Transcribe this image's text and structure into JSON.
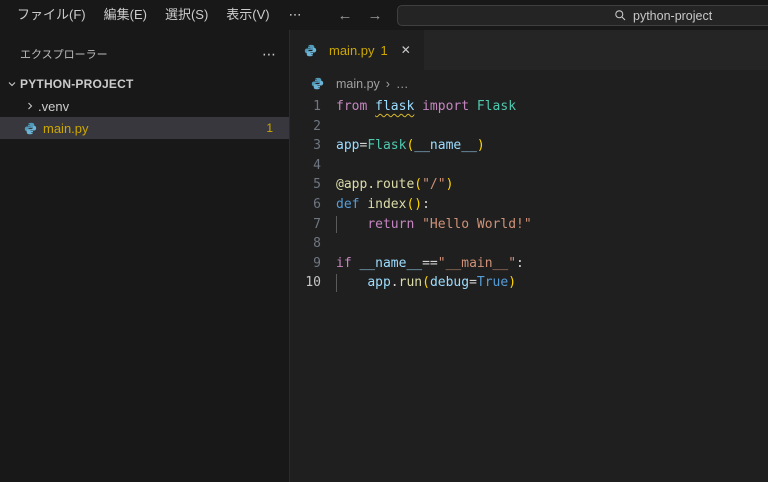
{
  "titlebar": {
    "menus": [
      "ファイル(F)",
      "編集(E)",
      "選択(S)",
      "表示(V)"
    ],
    "menu_more": "⋯",
    "back": "←",
    "forward": "→",
    "command_center": {
      "query": "python-project"
    }
  },
  "sidebar": {
    "header_title": "エクスプローラー",
    "header_more": "⋯",
    "root": {
      "label": "PYTHON-PROJECT"
    },
    "items": [
      {
        "label": ".venv",
        "kind": "folder-collapsed"
      },
      {
        "label": "main.py",
        "kind": "python-file",
        "badge": "1",
        "selected": true
      }
    ]
  },
  "editor": {
    "tab": {
      "label": "main.py",
      "badge": "1",
      "close": "✕"
    },
    "breadcrumb": {
      "file": "main.py",
      "separator": "›",
      "more": "…"
    },
    "code_lines": [
      {
        "n": 1,
        "tokens": [
          {
            "c": "kwc",
            "t": "from "
          },
          {
            "c": "var",
            "t": "flask",
            "sq": true
          },
          {
            "c": "pln",
            "t": " "
          },
          {
            "c": "kwc",
            "t": "import "
          },
          {
            "c": "cls",
            "t": "Flask"
          }
        ]
      },
      {
        "n": 2,
        "tokens": []
      },
      {
        "n": 3,
        "tokens": [
          {
            "c": "var",
            "t": "app"
          },
          {
            "c": "op",
            "t": "="
          },
          {
            "c": "cls",
            "t": "Flask"
          },
          {
            "c": "brk",
            "t": "("
          },
          {
            "c": "var",
            "t": "__name__"
          },
          {
            "c": "brk",
            "t": ")"
          }
        ]
      },
      {
        "n": 4,
        "tokens": []
      },
      {
        "n": 5,
        "tokens": [
          {
            "c": "fn",
            "t": "@app.route"
          },
          {
            "c": "brk",
            "t": "("
          },
          {
            "c": "str",
            "t": "\"/\""
          },
          {
            "c": "brk",
            "t": ")"
          }
        ]
      },
      {
        "n": 6,
        "tokens": [
          {
            "c": "kwb",
            "t": "def "
          },
          {
            "c": "fn",
            "t": "index"
          },
          {
            "c": "brk",
            "t": "()"
          },
          {
            "c": "op",
            "t": ":"
          }
        ]
      },
      {
        "n": 7,
        "indent": 4,
        "guide": true,
        "tokens": [
          {
            "c": "kwc",
            "t": "return "
          },
          {
            "c": "str",
            "t": "\"Hello World!\""
          }
        ]
      },
      {
        "n": 8,
        "tokens": []
      },
      {
        "n": 9,
        "tokens": [
          {
            "c": "kwc",
            "t": "if "
          },
          {
            "c": "var",
            "t": "__name__"
          },
          {
            "c": "op",
            "t": "=="
          },
          {
            "c": "str",
            "t": "\"__main__\""
          },
          {
            "c": "op",
            "t": ":"
          }
        ]
      },
      {
        "n": 10,
        "indent": 4,
        "guide": true,
        "active": true,
        "tokens": [
          {
            "c": "var",
            "t": "app"
          },
          {
            "c": "op",
            "t": "."
          },
          {
            "c": "fn",
            "t": "run"
          },
          {
            "c": "brk",
            "t": "("
          },
          {
            "c": "var",
            "t": "debug"
          },
          {
            "c": "op",
            "t": "="
          },
          {
            "c": "kwb",
            "t": "True"
          },
          {
            "c": "brk",
            "t": ")"
          }
        ]
      }
    ]
  },
  "palette": {
    "titlebar_bg": "#181818",
    "sidebar_bg": "#181818",
    "editor_bg": "#1f1f1f",
    "tabstrip_bg": "#252526",
    "selected_row_bg": "#37373d",
    "warning_gold": "#cca700",
    "python_icon_blue": "#519aba",
    "keyword_magenta": "#c586c0",
    "keyword_blue": "#569cd6",
    "variable_blue": "#9cdcfe",
    "class_teal": "#4ec9b0",
    "function_yellow": "#dcdcaa",
    "string_orange": "#ce9178",
    "bracket_gold": "#ffd700",
    "line_number_gray": "#6e7681",
    "ui_text": "#cccccc"
  }
}
